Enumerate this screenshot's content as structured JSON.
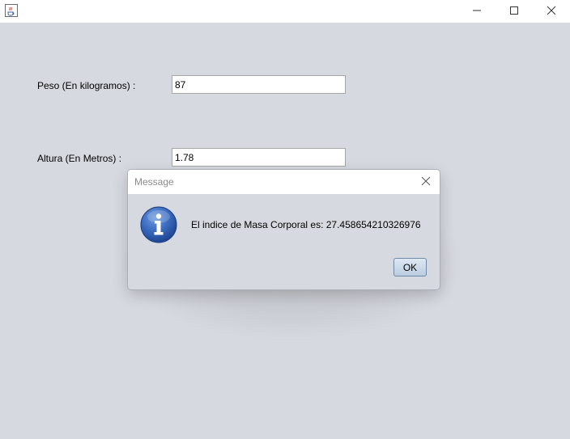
{
  "window": {
    "icon": "java-cup-icon",
    "controls": {
      "minimize": "minimize-icon",
      "maximize": "maximize-icon",
      "close": "close-icon"
    }
  },
  "form": {
    "peso_label": "Peso (En kilogramos) :",
    "peso_value": "87",
    "altura_label": "Altura (En Metros) :",
    "altura_value": "1.78"
  },
  "dialog": {
    "title": "Message",
    "icon": "information-icon",
    "message": "El indice de Masa Corporal es: 27.458654210326976",
    "ok_label": "OK"
  },
  "colors": {
    "background": "#d6d9e0",
    "titlebar": "#ffffff",
    "info_icon": "#2f5fa8"
  }
}
